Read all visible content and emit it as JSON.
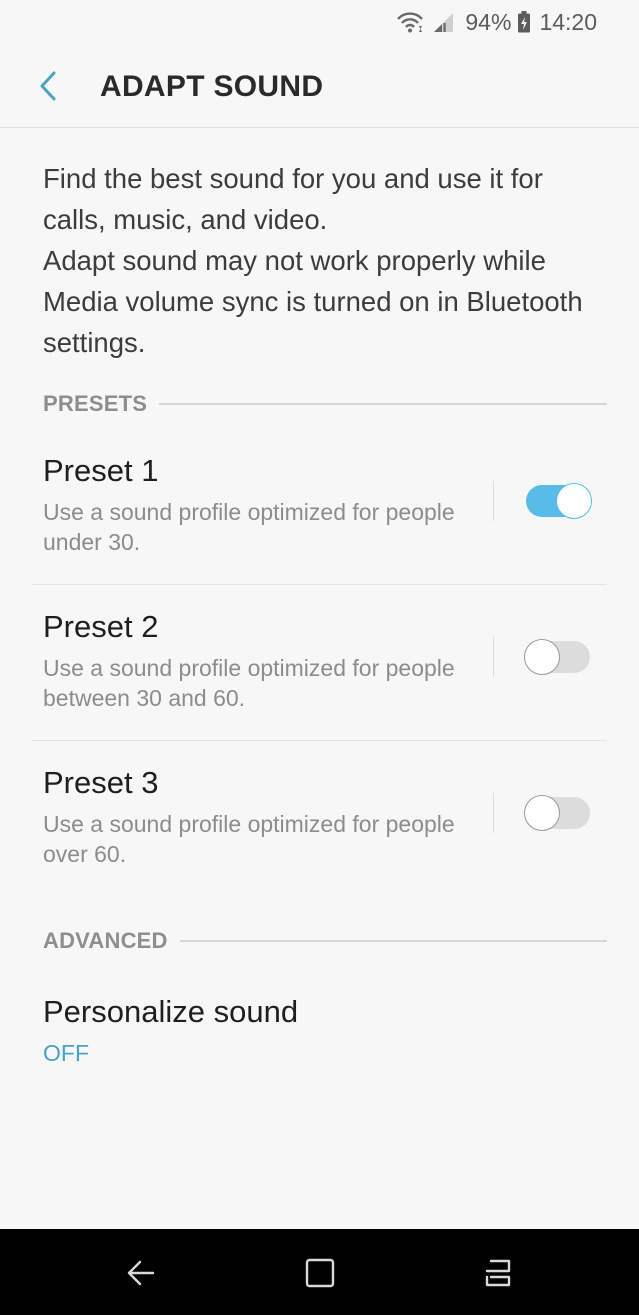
{
  "status_bar": {
    "battery_percent": "94%",
    "time": "14:20",
    "icons": [
      "wifi-icon",
      "signal-icon",
      "battery-charging-icon"
    ]
  },
  "header": {
    "title": "ADAPT SOUND",
    "back_icon": "chevron-left-icon"
  },
  "description": {
    "line1": "Find the best sound for you and use it for calls, music, and video.",
    "line2": "Adapt sound may not work properly while Media volume sync is turned on in Bluetooth settings."
  },
  "sections": {
    "presets_label": "PRESETS",
    "advanced_label": "ADVANCED"
  },
  "presets": [
    {
      "title": "Preset 1",
      "description": "Use a sound profile optimized for people under 30.",
      "enabled": true
    },
    {
      "title": "Preset 2",
      "description": "Use a sound profile optimized for people between 30 and 60.",
      "enabled": false
    },
    {
      "title": "Preset 3",
      "description": "Use a sound profile optimized for people over 60.",
      "enabled": false
    }
  ],
  "personalize": {
    "title": "Personalize sound",
    "status": "OFF"
  },
  "nav_bar": {
    "icons": [
      "back-icon",
      "home-icon",
      "recents-icon"
    ]
  },
  "colors": {
    "accent": "#57bde8",
    "link": "#4aa3c7",
    "background": "#f7f7f7"
  }
}
